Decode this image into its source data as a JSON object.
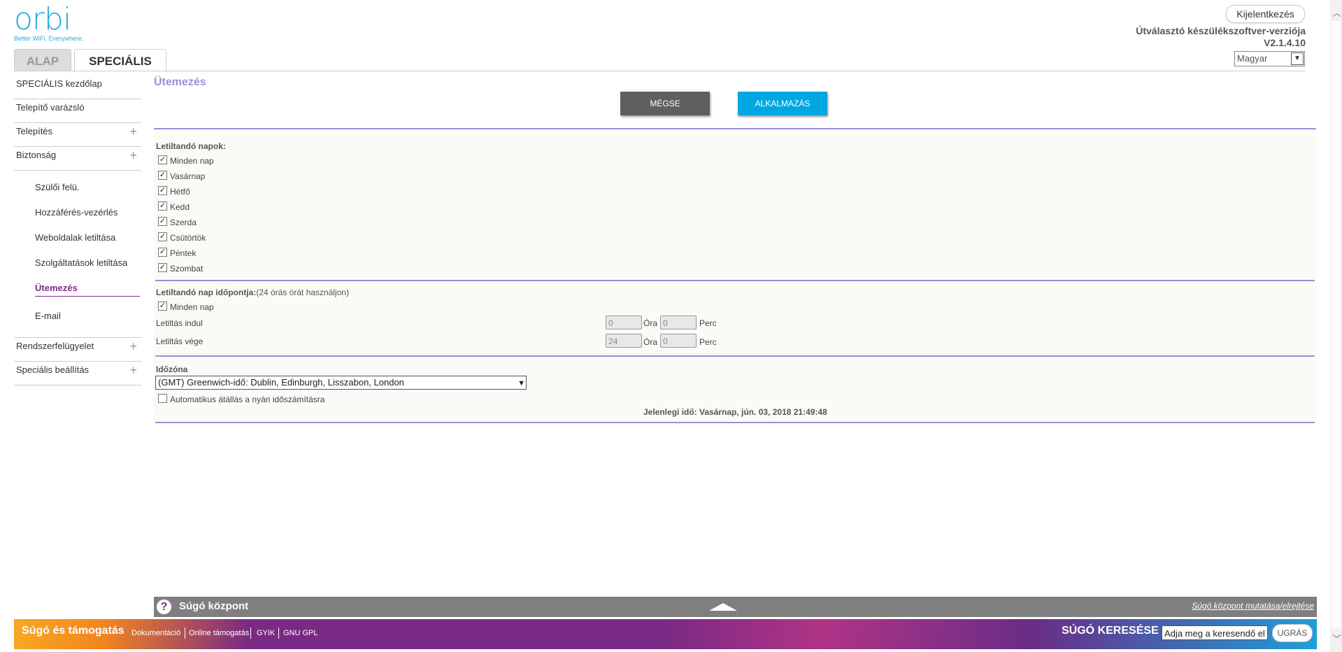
{
  "header": {
    "logo": "orbi",
    "tagline": "Better WiFi. Everywhere.",
    "logout_label": "Kijelentkezés",
    "firmware_label": "Útválasztó készülékszoftver-verziója",
    "firmware_version": "V2.1.4.10",
    "language_selected": "Magyar"
  },
  "tabs": [
    {
      "label": "ALAP",
      "active": false
    },
    {
      "label": "SPECIÁLIS",
      "active": true
    }
  ],
  "sidebar": {
    "items": [
      {
        "label": "SPECIÁLIS kezdőlap"
      },
      {
        "label": "Telepítő varázsló"
      },
      {
        "label": "Telepítés",
        "expandable": "+"
      },
      {
        "label": "Biztonság",
        "expandable": "+"
      }
    ],
    "sub_items": [
      {
        "label": "Szülői felü."
      },
      {
        "label": "Hozzáférés-vezérlés"
      },
      {
        "label": "Weboldalak letiltása"
      },
      {
        "label": "Szolgáltatások letiltása"
      },
      {
        "label": "Ütemezés",
        "active": true
      },
      {
        "label": "E-mail"
      }
    ],
    "items_after": [
      {
        "label": "Rendszerfelügyelet",
        "expandable": "+"
      },
      {
        "label": "Speciális beállítás",
        "expandable": "+"
      }
    ]
  },
  "main": {
    "title": "Ütemezés",
    "cancel_label": "MÉGSE",
    "apply_label": "ALKALMAZÁS",
    "days_title": "Letiltandó napok:",
    "days": [
      {
        "label": "Minden nap",
        "checked": true
      },
      {
        "label": "Vasárnap",
        "checked": true
      },
      {
        "label": "Hétfő",
        "checked": true
      },
      {
        "label": "Kedd",
        "checked": true
      },
      {
        "label": "Szerda",
        "checked": true
      },
      {
        "label": "Csütörtök",
        "checked": true
      },
      {
        "label": "Péntek",
        "checked": true
      },
      {
        "label": "Szombat",
        "checked": true
      }
    ],
    "time_title": "Letiltandó nap időpontja:",
    "time_hint": "(24 órás órát használjon)",
    "all_day_label": "Minden nap",
    "all_day_checked": true,
    "start_label": "Letiltás indul",
    "end_label": "Letiltás vége",
    "start_hour": "0",
    "start_minute": "0",
    "end_hour": "24",
    "end_minute": "0",
    "hour_unit": "Óra",
    "minute_unit": "Perc",
    "timezone_title": "Időzóna",
    "timezone_value": "(GMT) Greenwich-idő: Dublin, Edinburgh, Lisszabon, London",
    "dst_label": "Automatikus átállás a nyári időszámításra",
    "dst_checked": false,
    "current_time": "Jelenlegi idő: Vasárnap, jún. 03, 2018 21:49:48"
  },
  "help": {
    "icon": "?",
    "title": "Súgó központ",
    "toggle_label": "Súgó központ mutatása/elrejtése"
  },
  "footer": {
    "title": "Súgó és támogatás",
    "links": [
      "Dokumentáció",
      "Online támogatás",
      "GYIK",
      "GNU GPL"
    ],
    "search_label": "SÚGÓ KERESÉSE",
    "search_value": "Adja meg a keresendő el",
    "go_label": "UGRÁS"
  },
  "colors": {
    "accent_purple": "#9b8fd8",
    "apply_blue": "#00a7e1",
    "cancel_gray": "#5f5f60",
    "brand_blue": "#29aae1"
  }
}
